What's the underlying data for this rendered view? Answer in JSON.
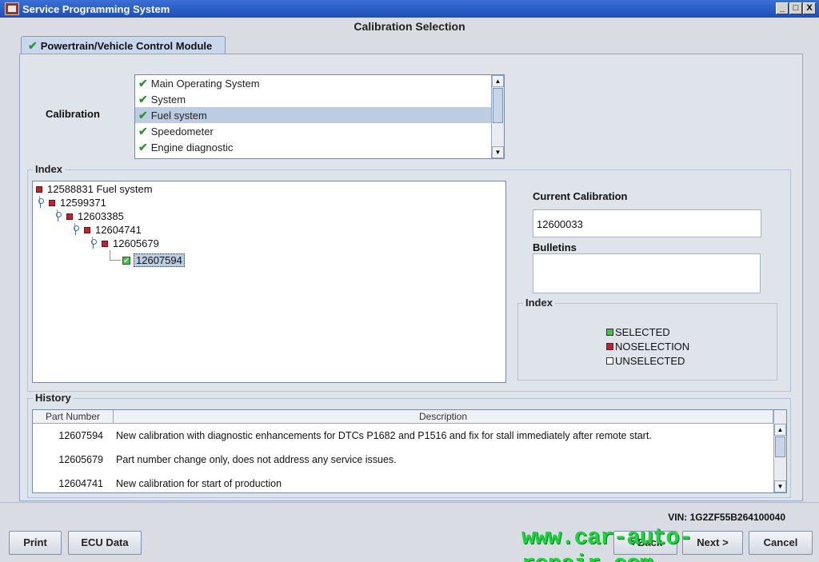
{
  "window": {
    "title": "Service Programming System",
    "heading": "Calibration Selection",
    "buttons": {
      "minimize": "_",
      "maximize": "□",
      "close": "X"
    }
  },
  "tab": {
    "label": "Powertrain/Vehicle Control Module"
  },
  "calibration": {
    "label": "Calibration",
    "items": [
      {
        "label": "Main Operating System"
      },
      {
        "label": "System"
      },
      {
        "label": "Fuel system"
      },
      {
        "label": "Speedometer"
      },
      {
        "label": "Engine diagnostic"
      }
    ],
    "selected": "Fuel system"
  },
  "index_group": {
    "label": "Index",
    "tree": [
      {
        "label": "12588831 Fuel system",
        "state": "noselection"
      },
      {
        "label": "12599371",
        "state": "noselection"
      },
      {
        "label": "12603385",
        "state": "noselection"
      },
      {
        "label": "12604741",
        "state": "noselection"
      },
      {
        "label": "12605679",
        "state": "noselection"
      },
      {
        "label": "12607594",
        "state": "selected"
      }
    ]
  },
  "current_calibration": {
    "label": "Current Calibration",
    "value": "12600033"
  },
  "bulletins": {
    "label": "Bulletins",
    "value": ""
  },
  "legend": {
    "label": "Index",
    "selected": "SELECTED",
    "noselection": "NOSELECTION",
    "unselected": "UNSELECTED",
    "colors": {
      "selected": "#4bbd4b",
      "noselection": "#c8202a",
      "unselected": "#ffffff"
    }
  },
  "history": {
    "label": "History",
    "columns": {
      "part_number": "Part Number",
      "description": "Description"
    },
    "rows": [
      {
        "pn": "12607594",
        "desc": "New calibration with diagnostic enhancements for DTCs P1682 and P1516 and fix for stall immediately after remote start."
      },
      {
        "pn": "12605679",
        "desc": "Part number change only, does not address any service issues."
      },
      {
        "pn": "12604741",
        "desc": "New calibration for start of production"
      }
    ]
  },
  "vin": "VIN: 1G2ZF55B264100040",
  "footer_buttons": {
    "print": "Print",
    "ecu_data": "ECU Data",
    "back": "< Back",
    "next": "Next >",
    "cancel": "Cancel"
  },
  "watermark": "www.car-auto-repair.com"
}
